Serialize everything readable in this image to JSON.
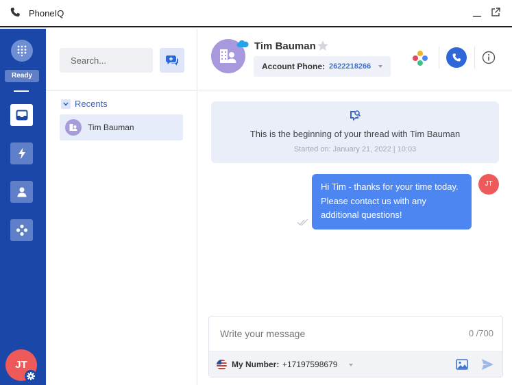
{
  "app": {
    "title": "PhoneIQ"
  },
  "rail": {
    "status": "Ready",
    "user_initials": "JT",
    "nav_icons": [
      "inbox-icon",
      "lightning-icon",
      "contacts-icon",
      "apps-icon"
    ]
  },
  "list": {
    "search_placeholder": "Search...",
    "section_label": "Recents",
    "contacts": [
      {
        "name": "Tim Bauman"
      }
    ]
  },
  "header": {
    "contact_name": "Tim Bauman",
    "account_phone_label": "Account Phone:",
    "account_phone": "2622218266"
  },
  "thread": {
    "banner_text": "This is the beginning of your thread with Tim Bauman",
    "started_on": "Started on: January 21, 2022 | 10:03",
    "messages": [
      {
        "text": "Hi Tim - thanks for your time today. Please contact us with any additional questions!",
        "sender_initials": "JT"
      }
    ]
  },
  "composer": {
    "placeholder": "Write your message",
    "char_count": "0 /700",
    "my_number_label": "My Number:",
    "my_number": "+17197598679"
  },
  "colors": {
    "rail": "#1b47a8",
    "accent": "#4d86f0",
    "avatar_red": "#ee5a5a",
    "contact_purple": "#a898dd"
  }
}
